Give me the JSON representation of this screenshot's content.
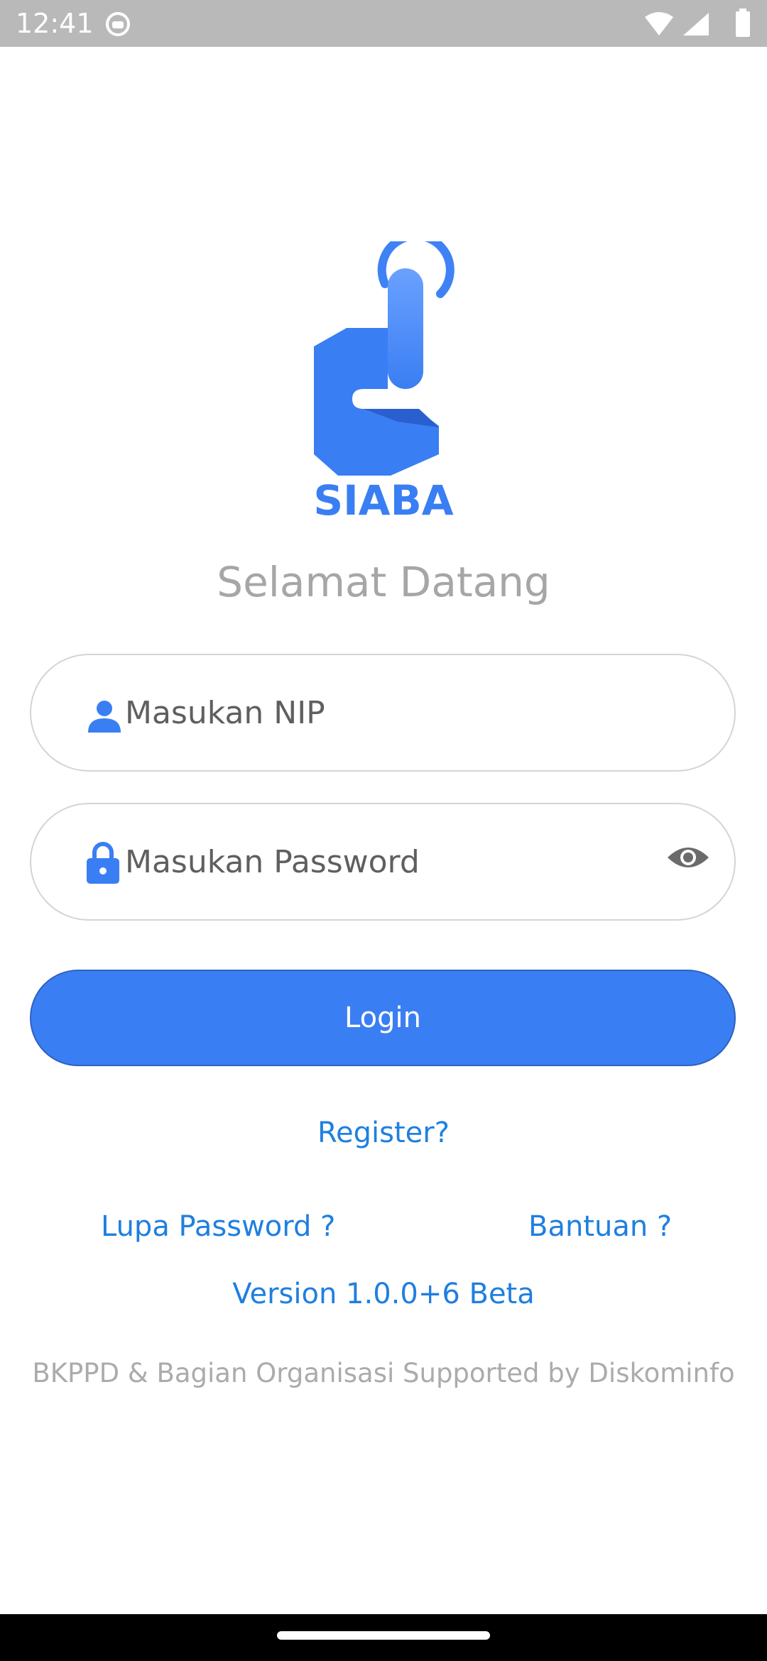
{
  "status_bar": {
    "time": "12:41",
    "icons": [
      "app-notification-icon",
      "wifi-icon",
      "signal-icon",
      "battery-icon"
    ]
  },
  "logo": {
    "text": "SIABA",
    "color": "#3a7ef3"
  },
  "welcome": "Selamat Datang",
  "nip_field": {
    "placeholder": "Masukan NIP",
    "icon": "person-icon"
  },
  "password_field": {
    "placeholder": "Masukan Password",
    "icon": "lock-icon",
    "toggle_icon": "eye-icon"
  },
  "login_button": {
    "label": "Login",
    "color": "#3a7ef3"
  },
  "links": {
    "register": "Register?",
    "forgot_password": "Lupa Password ?",
    "help": "Bantuan ?",
    "version": "Version 1.0.0+6 Beta"
  },
  "footer": "BKPPD & Bagian Organisasi Supported by Diskominfo"
}
